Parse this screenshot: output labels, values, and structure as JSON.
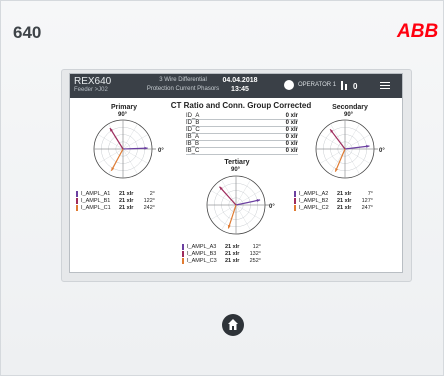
{
  "device": {
    "title": "640",
    "brand": "ABB"
  },
  "header": {
    "ied_name": "REX640",
    "feeder": "Feeder >J02",
    "view_title": "3 Wire Differential",
    "view_subtitle": "Protection Current Phasors",
    "date": "04.04.2018",
    "time": "13:45",
    "user": "OPERATOR 1",
    "alarm_count": "0"
  },
  "page": {
    "title": "CT Ratio and Conn. Group Corrected"
  },
  "ct_table": [
    {
      "label": "ID_A",
      "value": "0 xIr"
    },
    {
      "label": "ID_B",
      "value": "0 xIr"
    },
    {
      "label": "ID_C",
      "value": "0 xIr"
    },
    {
      "label": "IB_A",
      "value": "0 xIr"
    },
    {
      "label": "IB_B",
      "value": "0 xIr"
    },
    {
      "label": "IB_C",
      "value": "0 xIr"
    }
  ],
  "diagrams": {
    "primary": {
      "title": "Primary",
      "top_label": "90°",
      "right_label": "0°",
      "rows": [
        {
          "name": "I_AMPL_A1",
          "value": "21 xIr",
          "angle": "2°",
          "color": "#6b3fa0",
          "deg": 2
        },
        {
          "name": "I_AMPL_B1",
          "value": "21 xIr",
          "angle": "122°",
          "color": "#9e2b5c",
          "deg": 122
        },
        {
          "name": "I_AMPL_C1",
          "value": "21 xIr",
          "angle": "242°",
          "color": "#e07b32",
          "deg": 242
        }
      ]
    },
    "secondary": {
      "title": "Secondary",
      "top_label": "90°",
      "right_label": "0°",
      "rows": [
        {
          "name": "I_AMPL_A2",
          "value": "21 xIr",
          "angle": "7°",
          "color": "#6b3fa0",
          "deg": 7
        },
        {
          "name": "I_AMPL_B2",
          "value": "21 xIr",
          "angle": "127°",
          "color": "#9e2b5c",
          "deg": 127
        },
        {
          "name": "I_AMPL_C2",
          "value": "21 xIr",
          "angle": "247°",
          "color": "#e07b32",
          "deg": 247
        }
      ]
    },
    "tertiary": {
      "title": "Tertiary",
      "top_label": "90°",
      "right_label": "0°",
      "rows": [
        {
          "name": "I_AMPL_A3",
          "value": "21 xIr",
          "angle": "12°",
          "color": "#6b3fa0",
          "deg": 12
        },
        {
          "name": "I_AMPL_B3",
          "value": "21 xIr",
          "angle": "132°",
          "color": "#9e2b5c",
          "deg": 132
        },
        {
          "name": "I_AMPL_C3",
          "value": "21 xIr",
          "angle": "252°",
          "color": "#e07b32",
          "deg": 252
        }
      ]
    }
  },
  "icons": {
    "user": "user-icon",
    "level": "access-level-icon",
    "menu": "menu-icon",
    "home": "home-icon"
  }
}
